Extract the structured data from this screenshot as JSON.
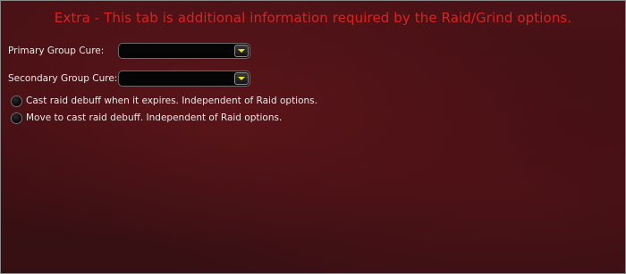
{
  "notice": "Extra - This tab is additional information required by the Raid/Grind options.",
  "fields": {
    "primary_cure": {
      "label": "Primary Group Cure:",
      "value": ""
    },
    "secondary_cure": {
      "label": "Secondary Group Cure:",
      "value": ""
    }
  },
  "options": {
    "cast_debuff": "Cast raid debuff when it expires. Independent of Raid options.",
    "move_to_cast": "Move to cast raid debuff. Independent of Raid options."
  },
  "icons": {
    "dropdown": "chevron-down-icon"
  },
  "colors": {
    "notice_text": "#e02020",
    "background": "#3e0f13",
    "dropdown_arrow": "#f0e020"
  }
}
